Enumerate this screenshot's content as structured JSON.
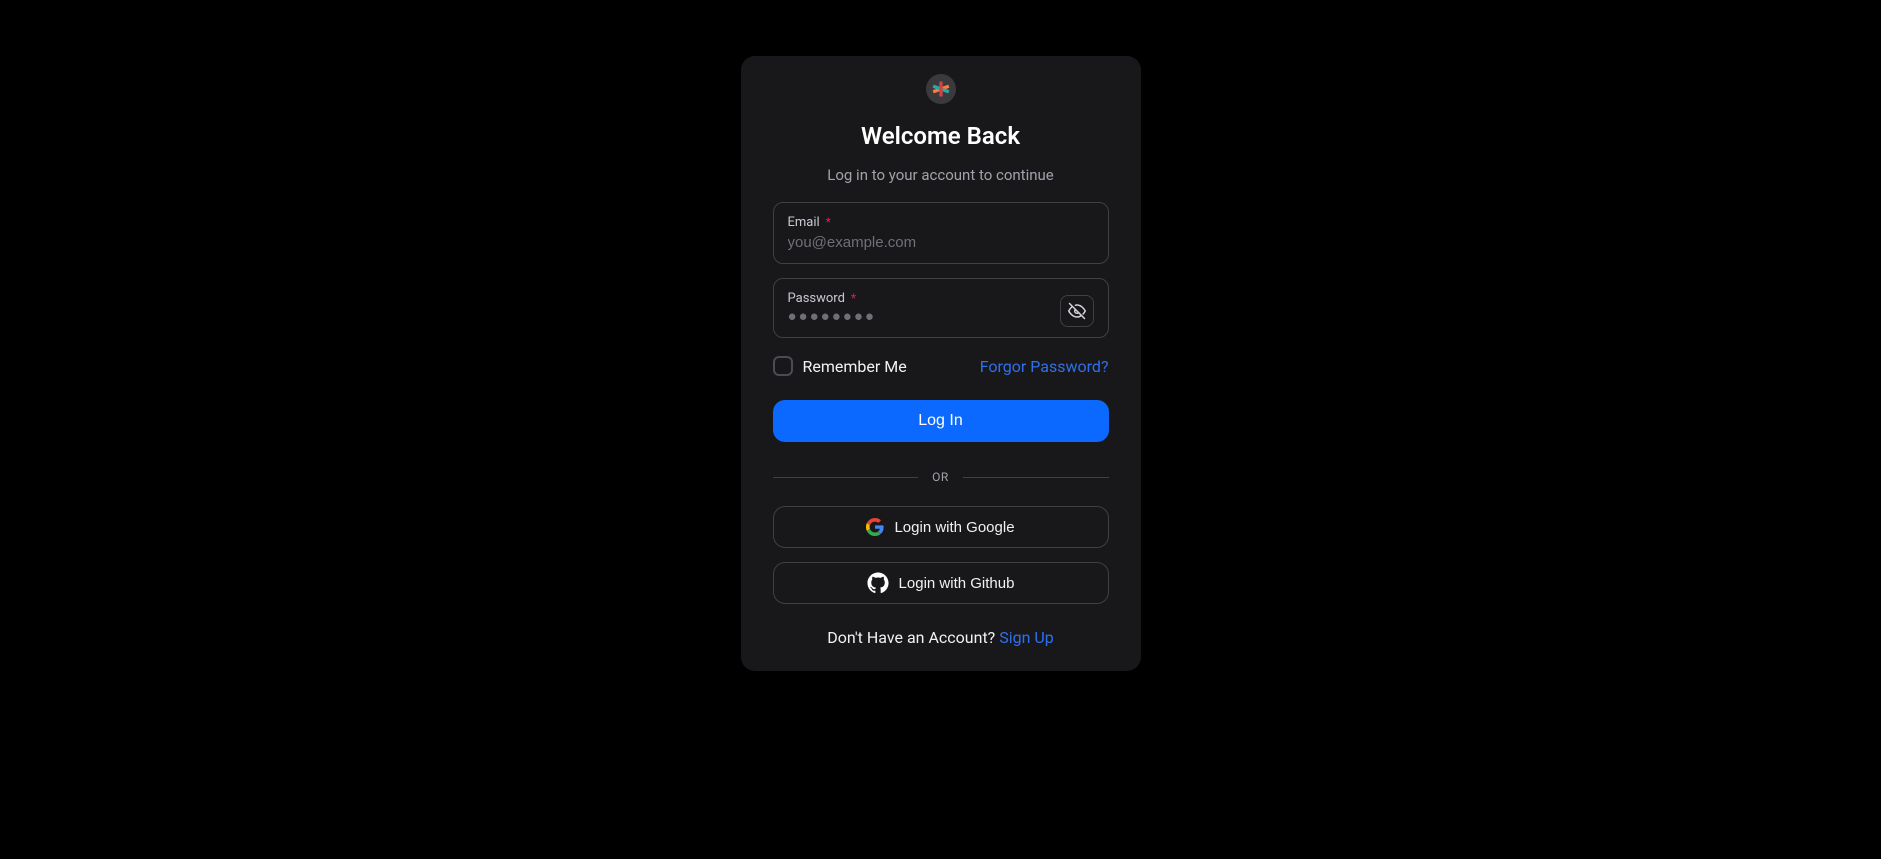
{
  "header": {
    "title": "Welcome Back",
    "subtitle": "Log in to your account to continue"
  },
  "form": {
    "email": {
      "label": "Email",
      "placeholder": "you@example.com",
      "value": "",
      "required": true
    },
    "password": {
      "label": "Password",
      "placeholder_mask": "●●●●●●●●",
      "value": "",
      "required": true
    },
    "remember": {
      "label": "Remember Me",
      "checked": false
    },
    "forgot_label": "Forgor Password?",
    "submit_label": "Log In"
  },
  "divider": {
    "label": "OR"
  },
  "social": {
    "google_label": "Login with Google",
    "github_label": "Login with Github"
  },
  "footer": {
    "prompt": "Don't Have an Account? ",
    "signup_label": "Sign Up"
  }
}
